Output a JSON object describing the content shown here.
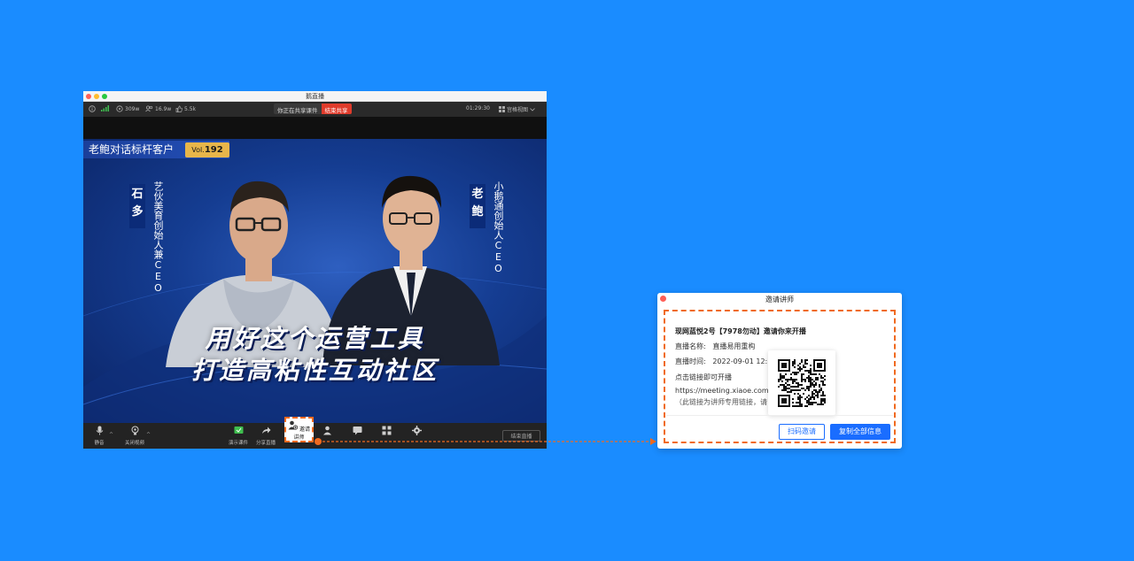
{
  "window": {
    "title": "鹅直播"
  },
  "statusbar": {
    "signal_value": "309w",
    "viewers": "16.9w",
    "likes": "5.5k",
    "share_status": "你正在共享课件",
    "stop_share": "结束共享",
    "time": "01:29:30",
    "layout_view": "宫格视图"
  },
  "stage": {
    "program_title": "老鲍对话标杆客户",
    "vol_label": "Vol.",
    "vol_number": "192",
    "guest_left_name": "石多",
    "guest_left_title": "艺伙美育创始人兼CEO",
    "guest_right_name": "老鲍",
    "guest_right_title": "小鹅通创始人CEO",
    "headline_line1": "用好这个运营工具",
    "headline_line2": "打造高粘性互动社区"
  },
  "toolbar": {
    "mute": "静音",
    "video": "关闭视频",
    "courseware": "演示课件",
    "share": "分享直播",
    "invite": "邀请讲师",
    "end_live": "结束直播"
  },
  "dialog": {
    "title": "邀请讲师",
    "heading": "现网蓝悦2号【7978勿动】邀请你来开播",
    "live_name_label": "直播名称:",
    "live_name_value": "直播易用重构",
    "live_time_label": "直播时间:",
    "live_time_value": "2022-09-01 12:",
    "click_link": "点击链接即可开播",
    "link": "https://meeting.xiaoe.com/",
    "note": "（此链接为讲师专用链接，请",
    "scan_invite": "扫码邀请",
    "copy_all": "复制全部信息"
  },
  "colors": {
    "background": "#1a8cff",
    "highlight": "#f06a1f",
    "primary": "#1a6dff"
  }
}
